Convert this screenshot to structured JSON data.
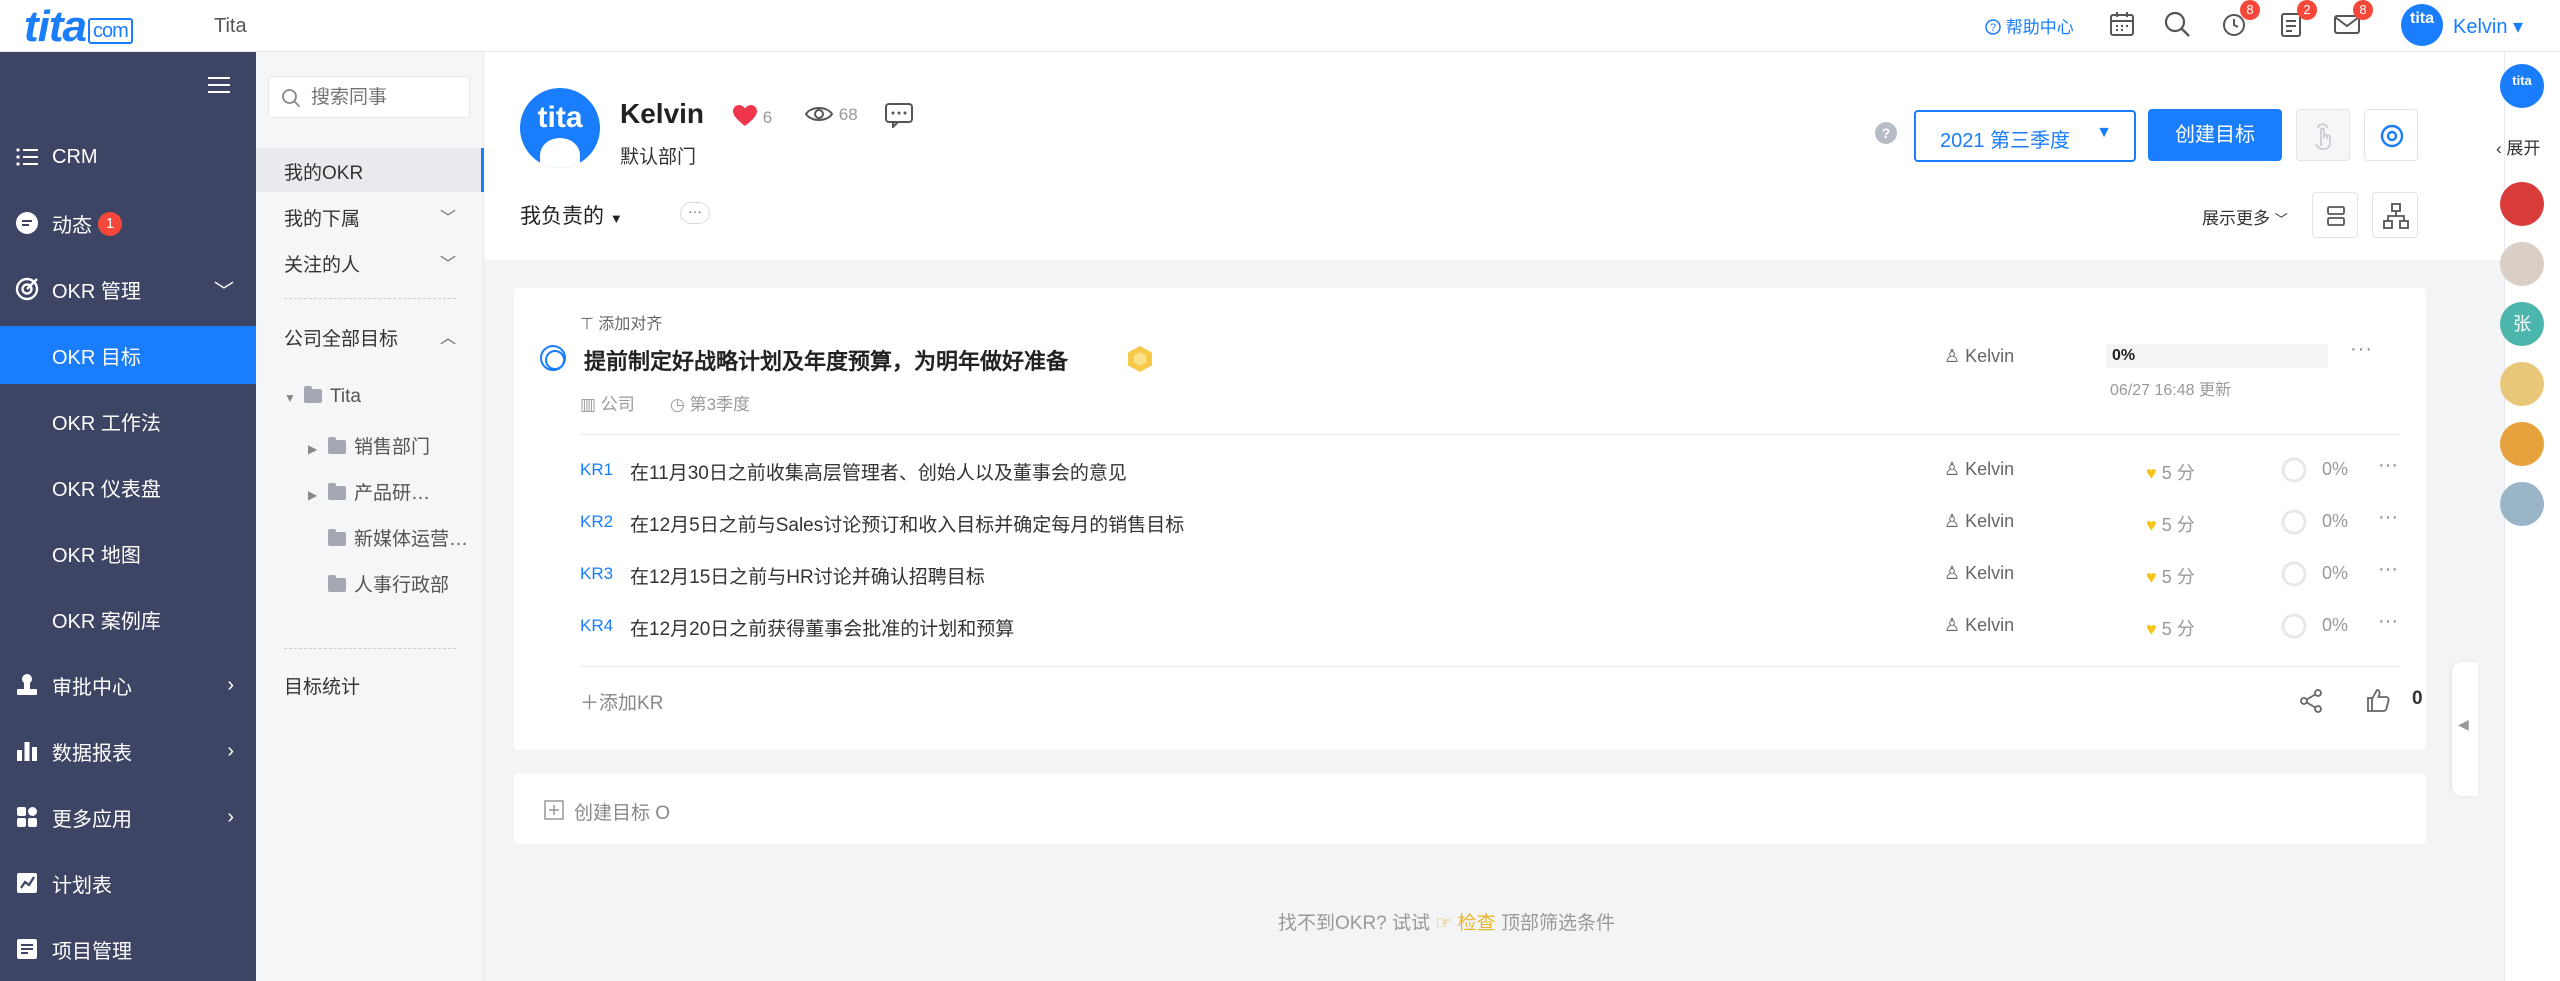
{
  "app": {
    "logo_text": "tita",
    "logo_domain": "com",
    "name": "Tita"
  },
  "topbar": {
    "help": "帮助中心",
    "badges": {
      "alarm": "8",
      "task": "2",
      "mail": "8"
    },
    "user_avatar_text": "tita",
    "user_name": "Kelvin ▾"
  },
  "sidebar": {
    "items": [
      {
        "label": "CRM",
        "icon": "list-icon"
      },
      {
        "label": "动态",
        "icon": "chat-icon",
        "badge": "1"
      },
      {
        "label": "OKR 管理",
        "icon": "target-icon",
        "chev": "﹀"
      },
      {
        "label": "OKR 目标"
      },
      {
        "label": "OKR 工作法"
      },
      {
        "label": "OKR 仪表盘"
      },
      {
        "label": "OKR 地图"
      },
      {
        "label": "OKR 案例库"
      },
      {
        "label": "审批中心",
        "icon": "stamp-icon",
        "chev": "›"
      },
      {
        "label": "数据报表",
        "icon": "bar-chart-icon",
        "chev": "›"
      },
      {
        "label": "更多应用",
        "icon": "apps-icon",
        "chev": "›"
      },
      {
        "label": "计划表",
        "icon": "plan-icon"
      },
      {
        "label": "项目管理",
        "icon": "project-icon"
      }
    ]
  },
  "col2": {
    "search_placeholder": "搜索同事",
    "my_okr": "我的OKR",
    "subordinates": "我的下属",
    "followed": "关注的人",
    "company_goals": "公司全部目标",
    "tree": [
      "Tita",
      "销售部门",
      "产品研…",
      "新媒体运营…",
      "人事行政部"
    ],
    "stats": "目标统计"
  },
  "header": {
    "avatar_text": "tita",
    "name": "Kelvin",
    "likes": "6",
    "views": "68",
    "dept": "默认部门",
    "quarter": "2021 第三季度",
    "create_btn": "创建目标",
    "responsible": "我负责的",
    "show_more": "展示更多"
  },
  "objective": {
    "align": "添加对齐",
    "title": "提前制定好战略计划及年度预算，为明年做好准备",
    "scope": "公司",
    "period": "第3季度",
    "owner": "Kelvin",
    "progress_text": "0%",
    "progress": 0,
    "updated": "06/27 16:48 更新",
    "krs": [
      {
        "tag": "KR1",
        "text": "在11月30日之前收集高层管理者、创始人以及董事会的意见",
        "owner": "Kelvin",
        "score": "5 分",
        "pct": "0%"
      },
      {
        "tag": "KR2",
        "text": "在12月5日之前与Sales讨论预订和收入目标并确定每月的销售目标",
        "owner": "Kelvin",
        "score": "5 分",
        "pct": "0%"
      },
      {
        "tag": "KR3",
        "text": "在12月15日之前与HR讨论并确认招聘目标",
        "owner": "Kelvin",
        "score": "5 分",
        "pct": "0%"
      },
      {
        "tag": "KR4",
        "text": "在12月20日之前获得董事会批准的计划和预算",
        "owner": "Kelvin",
        "score": "5 分",
        "pct": "0%"
      }
    ],
    "add_kr": "添加KR",
    "like_count": "0"
  },
  "create_obj": "创建目标 O",
  "hint": {
    "pre": "找不到OKR? 试试",
    "em": "检查",
    "post": "顶部筛选条件"
  },
  "rail": {
    "expand": "展开",
    "avatar_letter": "张"
  },
  "colors": {
    "accent": "#1a7dfc",
    "sidebar": "#3e4564",
    "badge": "#f5483b",
    "gold": "#f5c518"
  }
}
